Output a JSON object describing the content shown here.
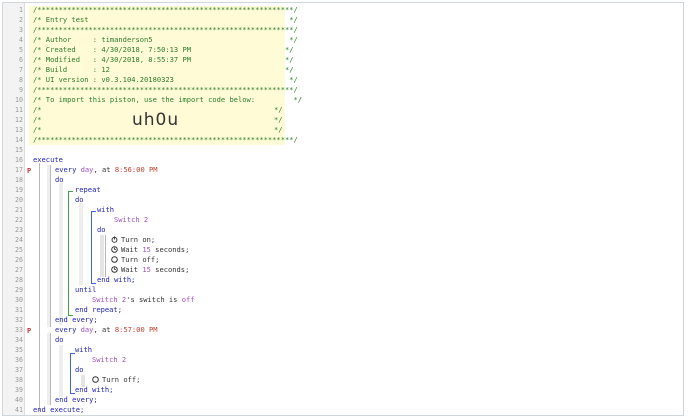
{
  "header": {
    "rule": "/************************************************************/",
    "title": "/* Entry test                                               */",
    "author": "/* Author     : timanderson5                                */",
    "created": "/* Created    : 4/30/2018, 7:50:13 PM                      */",
    "modified": "/* Modified   : 4/30/2018, 8:55:37 PM                      */",
    "build": "/* Build      : 12                                         */",
    "ui": "/* UI version : v0.3.104.20180323                           */",
    "import_text": "/* To import this piston, use the import code below:         */",
    "blank_open": "/*",
    "blank_close": "*/",
    "import_code": "uh0u"
  },
  "line_numbers": [
    "1",
    "2",
    "3",
    "4",
    "5",
    "6",
    "7",
    "8",
    "9",
    "10",
    "11",
    "12",
    "13",
    "14",
    "15",
    "16",
    "17",
    "18",
    "19",
    "20",
    "21",
    "22",
    "23",
    "24",
    "25",
    "26",
    "27",
    "28",
    "29",
    "30",
    "31",
    "32",
    "33",
    "34",
    "35",
    "36",
    "37",
    "38",
    "39",
    "40",
    "41"
  ],
  "program": {
    "execute": "execute",
    "end_execute": "end execute;",
    "block1": {
      "every": "every",
      "day": "day",
      "at": ", at",
      "time": "8:56:00 PM",
      "do": "do",
      "repeat": "repeat",
      "repeat_do": "do",
      "with": "with",
      "device": "Switch 2",
      "with_do": "do",
      "actions": [
        {
          "icon": "power-icon",
          "text": "Turn on;"
        },
        {
          "icon": "timer-icon",
          "pre": "Wait ",
          "num": "15",
          "post": " seconds;"
        },
        {
          "icon": "circle-icon",
          "text": "Turn off;"
        },
        {
          "icon": "timer-icon",
          "pre": "Wait ",
          "num": "15",
          "post": " seconds;"
        }
      ],
      "end_with": "end with;",
      "until": "until",
      "cond_device": "Switch 2",
      "cond_rest": "'s switch is ",
      "cond_value": "off",
      "end_repeat": "end repeat;",
      "end_every": "end every;"
    },
    "block2": {
      "every": "every",
      "day": "day",
      "at": ", at",
      "time": "8:57:00 PM",
      "do": "do",
      "with": "with",
      "device": "Switch 2",
      "with_do": "do",
      "action": "Turn off;",
      "end_with": "end with;",
      "end_every": "end every;"
    }
  },
  "markers": {
    "row17": "P",
    "row33": "P"
  },
  "colors": {
    "comment": "#2a7d2a",
    "keyword": "#2222bb",
    "value": "#a050c0",
    "time": "#c04030",
    "comment_background": "#fffbd6"
  }
}
